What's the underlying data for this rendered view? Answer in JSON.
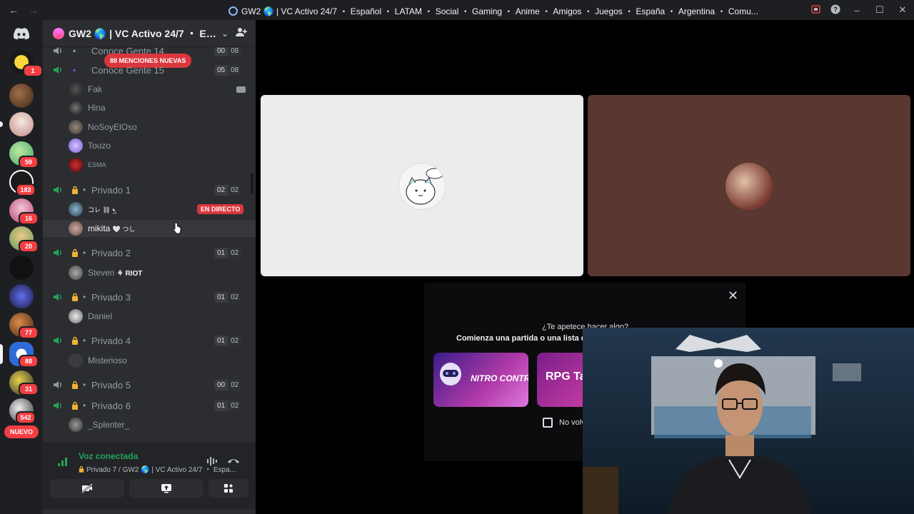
{
  "window": {
    "title": "GW2 🌎 | VC Activo 24/7 ・ Español ・ LATAM ・ Social ・ Gaming ・ Anime ・ Amigos ・ Juegos ・ España ・ Argentina ・ Comu..."
  },
  "rail": {
    "badges": [
      "1",
      "59",
      "183",
      "16",
      "20",
      "77",
      "88",
      "31",
      "542"
    ],
    "nuevo": "NUEVO"
  },
  "server": {
    "name": "GW2 🌎 | VC Activo 24/7 ・ Espa..."
  },
  "channels": {
    "mentions": "88 MENCIONES NUEVAS",
    "items": [
      {
        "name": "Conoce Gente 14",
        "count_a": "00",
        "count_b": "08"
      },
      {
        "name": "Conoce Gente 15",
        "count_a": "05",
        "count_b": "08"
      },
      {
        "name": "Privado 1",
        "count_a": "02",
        "count_b": "02"
      },
      {
        "name": "Privado 2",
        "count_a": "01",
        "count_b": "02"
      },
      {
        "name": "Privado 3",
        "count_a": "01",
        "count_b": "02"
      },
      {
        "name": "Privado 4",
        "count_a": "01",
        "count_b": "02"
      },
      {
        "name": "Privado 5",
        "count_a": "00",
        "count_b": "02"
      },
      {
        "name": "Privado 6",
        "count_a": "01",
        "count_b": "02"
      }
    ],
    "members": {
      "fak": "Fak",
      "hina": "Hina",
      "nosoy": "NoSoyElOso",
      "touzo": "Touzo",
      "esma": "ESMA",
      "p1_first": "コレ ⛓ •̴̲",
      "p1_second": "mikita",
      "p1_second_tag": "🤍 つし",
      "steven": "Steven",
      "steven_tag": "RIOT",
      "daniel": "Daniel",
      "misterioso": "Misterioso",
      "splenter": "_Splenter_"
    },
    "live": "EN DIRECTO"
  },
  "voice": {
    "status": "Voz conectada",
    "channel": "Privado 7 / GW2 🌎 | VC Activo 24/7 ・ Espa..."
  },
  "activity": {
    "question": "¿Te apetece hacer algo?",
    "subtitle": "Comienza una partida o una lista de",
    "games": [
      "NITRO CONTROL",
      "RPG Ta"
    ],
    "checkbox_label": "No volv"
  },
  "colors": {
    "rail_bg": "#1e1f22",
    "sidebar_bg": "#2b2d31",
    "mention_red": "#da373c",
    "connected_green": "#23a55a",
    "tile_light": "#ececec",
    "tile_brown": "#5a3731"
  }
}
